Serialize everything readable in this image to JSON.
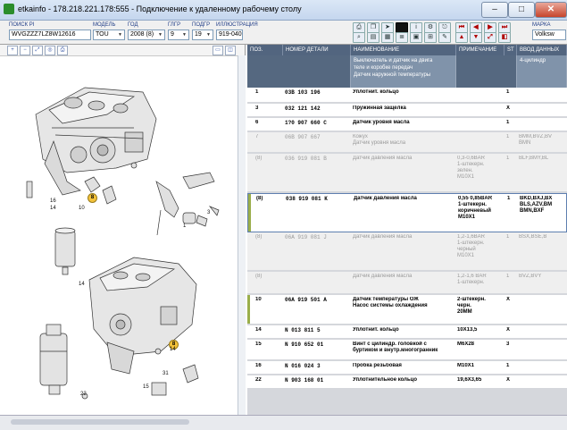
{
  "window": {
    "title": "etkainfo - 178.218.221.178:555 - Подключение к удаленному рабочему столу",
    "minimize": "–",
    "maximize": "□",
    "close": "✕"
  },
  "toolbar": {
    "search_label": "ПОИСК PI",
    "search_value": "WVGZZZ7LZ8W12616",
    "model_label": "МОДЕЛЬ",
    "model_value": "TOU",
    "year_label": "ГОД",
    "year_value": "2008 (8)",
    "group_label": "ГЛГР",
    "group_value": "9",
    "subgroup_label": "ПОДГР",
    "subgroup_value": "19",
    "illustration_label": "ИЛЛЮСТРАЦИЯ",
    "illustration_value": "919-040",
    "brand_label": "МАРКА",
    "brand_value": "Volksw"
  },
  "table": {
    "headers": {
      "pos": "ПОЗ.",
      "number": "НОМЕР ДЕТАЛИ",
      "name": "НАИМЕНОВАНИЕ",
      "note": "ПРИМЕЧАНИЕ",
      "st": "ST",
      "vvod": "ВВОД ДАННЫХ"
    },
    "group_title": "Выключатель и датчик на двига\nтеле и коробке передач\nДатчик наружной температуры",
    "group_vvod": "4-цилиндр",
    "rows": [
      {
        "pos": "1",
        "number": "03B 103 196",
        "name": "Уплотнит. кольцо",
        "note": "",
        "st": "1",
        "vvod": ""
      },
      {
        "pos": "3",
        "number": "032 121 142",
        "name": "Пружинная защелка",
        "note": "",
        "st": "X",
        "vvod": ""
      },
      {
        "pos": "6",
        "number": "1?0 907 660 C",
        "name": "Датчик уровня масла",
        "note": "",
        "st": "1",
        "vvod": ""
      },
      {
        "pos": "7",
        "number": "06B 907 667",
        "name": "Кожух\nДатчик уровня масла",
        "note": "",
        "st": "1",
        "vvod": "BMM,BVZ,BV\nBMN"
      },
      {
        "pos": "(8)",
        "number": "036 919 081 B",
        "name": "Датчик давления масла",
        "note": "0,3-0,6BAR\n1-штекерн.\nзелен.\nM10X1",
        "st": "1",
        "vvod": "BLF,BMY,BL"
      },
      {
        "pos": "(8)",
        "number": "038 919 081 K",
        "name": "Датчик давления масла",
        "note": "0,55 0,85BAR\n1-штекерн.\nкоричневый\nM10X1",
        "st": "1",
        "vvod": "BKD,BXJ,BX\nBLS,AZV,BM\nBMN,BXF"
      },
      {
        "pos": "(8)",
        "number": "06A 919 081 J",
        "name": "Датчик давления масла",
        "note": "1,2-1,6BAR\n1-штекерн.\nчерный\nM10X1",
        "st": "1",
        "vvod": "BSX,BSE,B"
      },
      {
        "pos": "(8)",
        "number": "",
        "name": "Датчик давления масла",
        "note": "1,2-1,6 BAR\n1-штекерн.",
        "st": "1",
        "vvod": "BVZ,BVY"
      },
      {
        "pos": "10",
        "number": "06A 919 501 A",
        "name": "Датчик температуры ОЖ\nНасос системы охлаждения",
        "note": "2-штекерн.\nчерн.\n20MM",
        "st": "X",
        "vvod": ""
      },
      {
        "pos": "14",
        "number": "N 013 811 5",
        "name": "Уплотнит. кольцо",
        "note": "10X13,5",
        "st": "X",
        "vvod": ""
      },
      {
        "pos": "15",
        "number": "N 910 652 01",
        "name": "Винт с цилиндр. головкой с\nбуртиком и внутр.многогранник",
        "note": "M6X28",
        "st": "3",
        "vvod": ""
      },
      {
        "pos": "16",
        "number": "N 016 024 3",
        "name": "Пробка резьбовая",
        "note": "M10X1",
        "st": "1",
        "vvod": ""
      },
      {
        "pos": "22",
        "number": "N 903 168 01",
        "name": "Уплотнительное кольцо",
        "note": "19,6X3,65",
        "st": "X",
        "vvod": ""
      }
    ]
  },
  "diagram": {
    "labels": [
      "16",
      "14",
      "8",
      "10",
      "14",
      "3",
      "1",
      "31",
      "15",
      "22"
    ]
  },
  "colors": {
    "header": "#52657f",
    "subheader": "#8093aa",
    "callout": "#f3c23a",
    "marker": "#9aae4a"
  }
}
